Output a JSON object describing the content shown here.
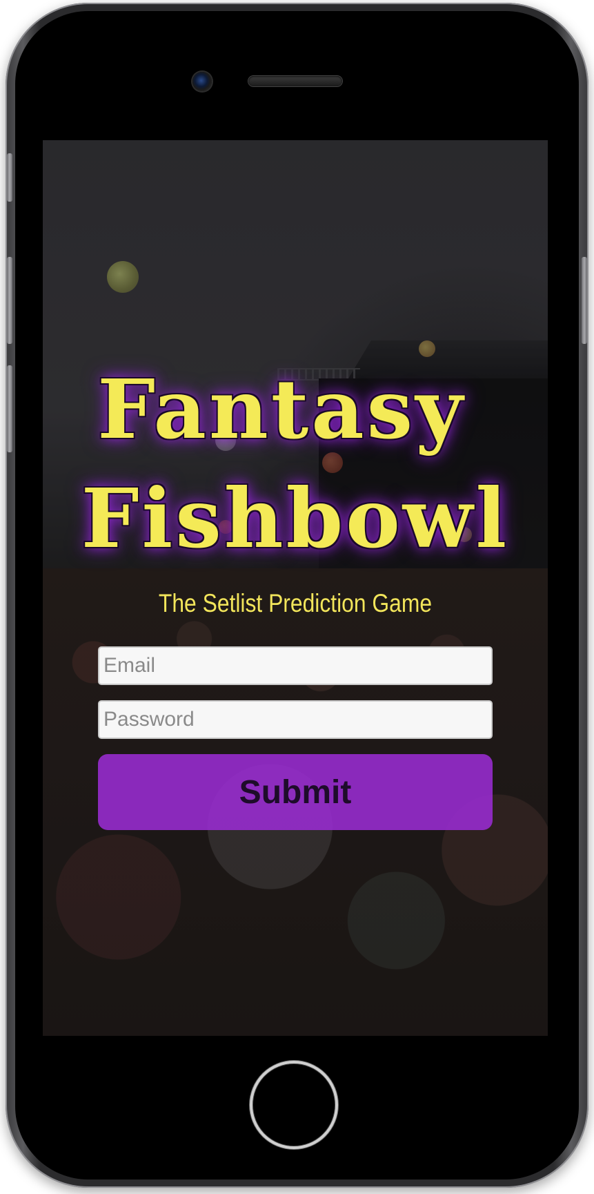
{
  "app": {
    "title_line_1": "Fantasy",
    "title_line_2": "Fishbowl",
    "subtitle": "The Setlist Prediction Game"
  },
  "form": {
    "email": {
      "value": "",
      "placeholder": "Email"
    },
    "password": {
      "value": "",
      "placeholder": "Password"
    },
    "submit_label": "Submit"
  },
  "colors": {
    "title_yellow": "#f4ea57",
    "title_glow": "#9628dc",
    "button_purple": "#9c2cd6",
    "device_black": "#000000"
  },
  "icons": {
    "camera": "front-camera-icon",
    "speaker": "earpiece-speaker-icon",
    "home": "home-button-icon"
  }
}
